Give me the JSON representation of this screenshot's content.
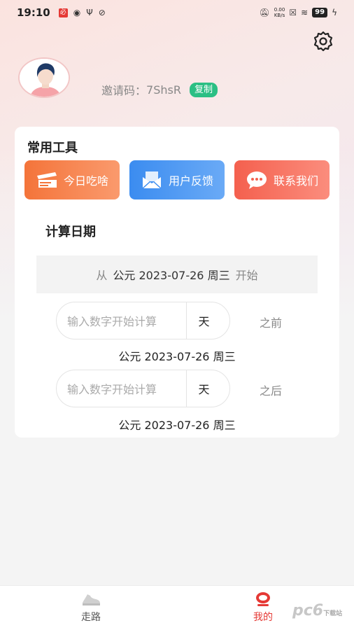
{
  "status_bar": {
    "time": "19:10",
    "speed_value": "0.00",
    "speed_unit": "KB/s",
    "battery": "99"
  },
  "profile": {
    "invite_label": "邀请码：",
    "invite_code": "7ShsR",
    "copy_label": "复制"
  },
  "tools": {
    "title": "常用工具",
    "items": [
      {
        "label": "今日吃啥",
        "icon": "food-box-icon"
      },
      {
        "label": "用户反馈",
        "icon": "envelope-icon"
      },
      {
        "label": "联系我们",
        "icon": "chat-bubble-icon"
      }
    ]
  },
  "calc": {
    "title": "计算日期",
    "from_prefix": "从",
    "from_date": "公元 2023-07-26 周三",
    "from_suffix": "开始",
    "rows": [
      {
        "placeholder": "输入数字开始计算",
        "unit": "天",
        "direction": "之前",
        "result": "公元 2023-07-26 周三"
      },
      {
        "placeholder": "输入数字开始计算",
        "unit": "天",
        "direction": "之后",
        "result": "公元 2023-07-26 周三"
      }
    ]
  },
  "nav": {
    "items": [
      {
        "label": "走路",
        "active": false
      },
      {
        "label": "我的",
        "active": true
      }
    ]
  },
  "watermark": {
    "text": "pc6",
    "sub": "下载站"
  },
  "colors": {
    "accent_green": "#2bbf84",
    "active_red": "#e53935",
    "tool_orange": "#f4743a",
    "tool_blue": "#3b8cf0",
    "tool_red": "#f4604e"
  }
}
